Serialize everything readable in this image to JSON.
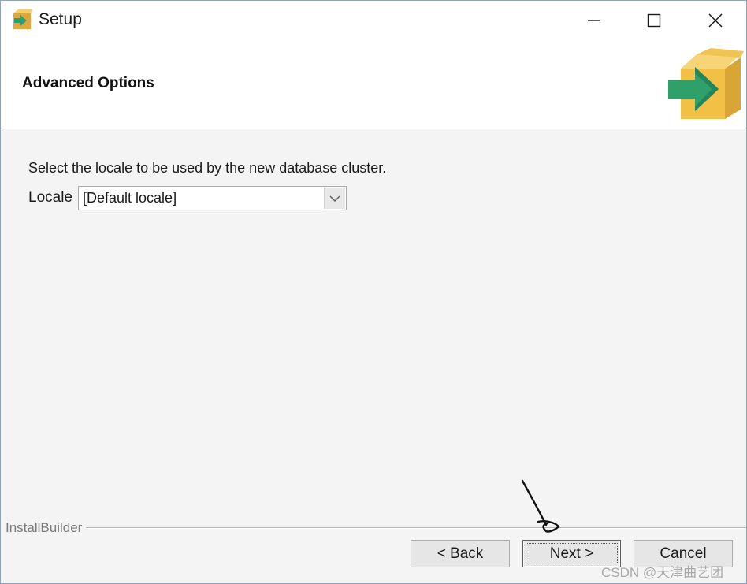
{
  "window": {
    "title": "Setup"
  },
  "header": {
    "title": "Advanced Options"
  },
  "body": {
    "instruction": "Select the locale to be used by the new database cluster.",
    "locale_label": "Locale",
    "locale_value": "[Default locale]"
  },
  "footer": {
    "brand": "InstallBuilder",
    "back_label": "< Back",
    "next_label": "Next >",
    "cancel_label": "Cancel"
  },
  "watermark": "CSDN @天津曲艺团",
  "colors": {
    "logo_box": "#f2c044",
    "logo_arrow": "#2fa06a",
    "focus_border": "#0078d7"
  },
  "icons": {
    "app": "setup-box-arrow-icon",
    "minimize": "minimize-icon",
    "maximize": "maximize-icon",
    "close": "close-icon",
    "dropdown": "chevron-down-icon",
    "header_logo": "box-arrow-logo"
  }
}
